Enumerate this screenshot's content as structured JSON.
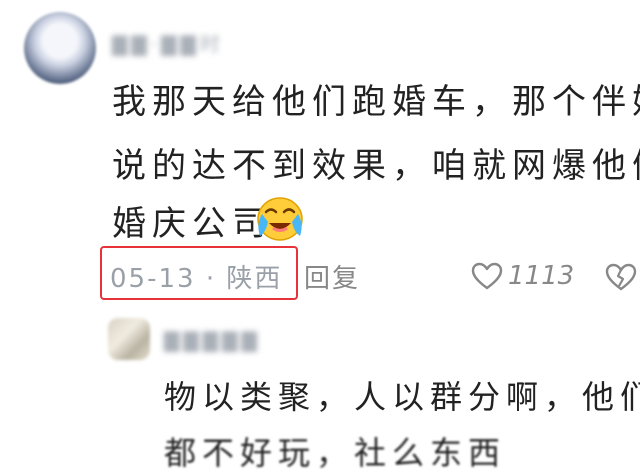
{
  "comment": {
    "username": "▇▇·▇▇时",
    "lines": [
      "我那天给他们跑婚车，那个伴娘",
      "说的达不到效果，咱就网爆他们",
      "婚庆公司"
    ],
    "emoji": "crying-laughing-emoji",
    "date": "05-13",
    "separator": "·",
    "location": "陕西",
    "reply_label": "回复",
    "like_count": "1113"
  },
  "reply": {
    "username": "▇▇▇▇▇",
    "lines": [
      "物以类聚，人以群分啊，他们",
      "都不好玩，社么东西"
    ]
  },
  "colors": {
    "highlight_box": "#e8323a",
    "meta_text": "#9aa0a8",
    "body_text": "#222222"
  }
}
